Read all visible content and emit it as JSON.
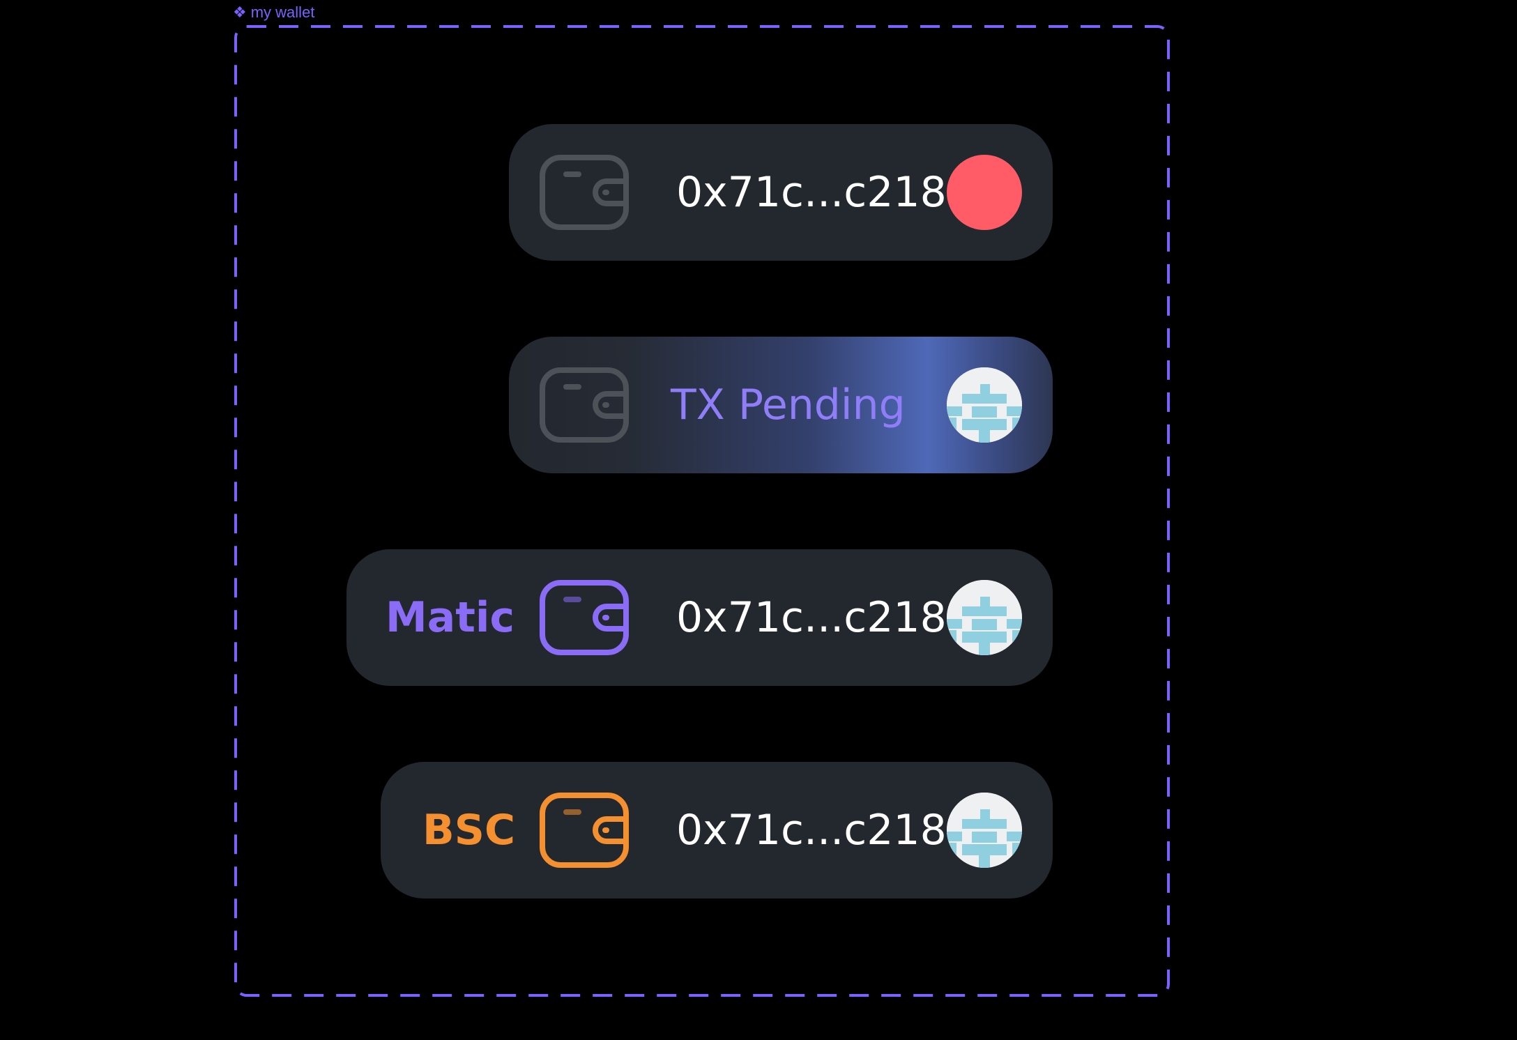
{
  "frame": {
    "label": "my wallet",
    "icon": "component-diamond-icon",
    "accent_color": "#7b61ff"
  },
  "wallets": [
    {
      "state": "disconnected",
      "address": "0x71c...c218",
      "wallet_icon": "wallet-icon",
      "icon_color": "#4d5259",
      "status_icon": "error-dot-icon",
      "status_color": "#ff5c67"
    },
    {
      "state": "pending",
      "status_text": "TX Pending",
      "status_text_color": "#8f7ef7",
      "wallet_icon": "wallet-icon",
      "icon_color": "#4d5259",
      "avatar_icon": "identicon-avatar-icon",
      "avatar_color": "#8fcfe0"
    },
    {
      "state": "connected",
      "chain": "Matic",
      "chain_color": "#8b6cf6",
      "address": "0x71c...c218",
      "wallet_icon": "wallet-icon",
      "icon_color": "#8b6cf6",
      "avatar_icon": "identicon-avatar-icon",
      "avatar_color": "#8fcfe0"
    },
    {
      "state": "connected",
      "chain": "BSC",
      "chain_color": "#f4902f",
      "address": "0x71c...c218",
      "wallet_icon": "wallet-icon",
      "icon_color": "#f4902f",
      "avatar_icon": "identicon-avatar-icon",
      "avatar_color": "#8fcfe0"
    }
  ]
}
